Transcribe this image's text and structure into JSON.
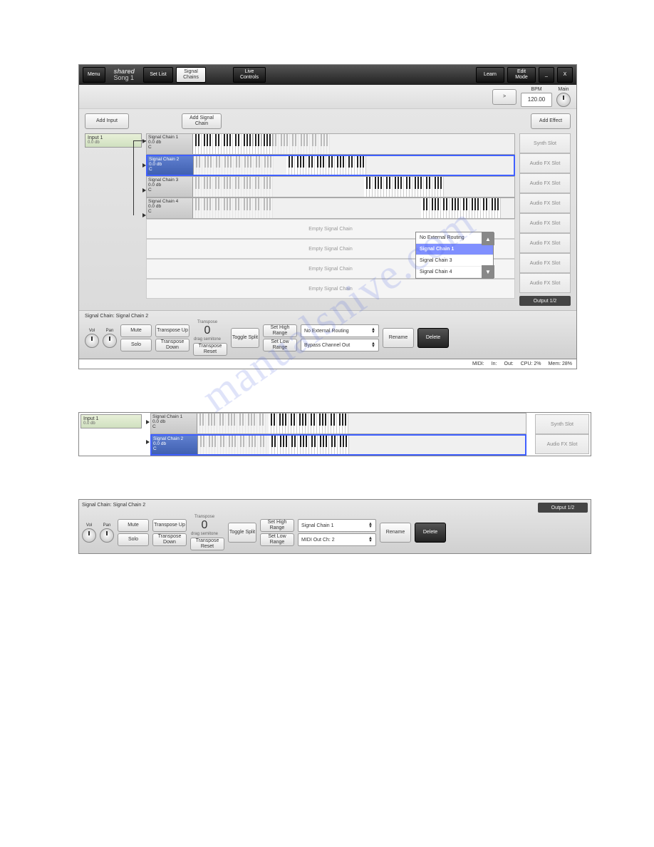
{
  "topbar": {
    "menu": "Menu",
    "shared": "shared",
    "song": "Song 1",
    "setlist": "Set\nList",
    "signalchains": "Signal\nChains",
    "livecontrols": "Live\nControls",
    "learn": "Learn",
    "editmode": "Edit\nMode",
    "min": "_",
    "close": "X"
  },
  "subhead": {
    "play": ">",
    "bpm_label": "BPM",
    "bpm": "120.00",
    "main": "Main"
  },
  "buttons": {
    "addinput": "Add Input",
    "addchain": "Add\nSignal Chain",
    "addeffect": "Add Effect"
  },
  "input": {
    "name": "Input 1",
    "level": "0.0 db"
  },
  "chains": [
    {
      "name": "Signal Chain 1",
      "db": "0.0 db",
      "note": "C"
    },
    {
      "name": "Signal Chain 2",
      "db": "0.0 db",
      "note": "C"
    },
    {
      "name": "Signal Chain 3",
      "db": "0.0 db",
      "note": "C"
    },
    {
      "name": "Signal Chain 4",
      "db": "0.0 db",
      "note": "C"
    }
  ],
  "empties": [
    "Empty Signal Chain",
    "Empty Signal Chain",
    "Empty Signal Chain",
    "Empty Signal Chain"
  ],
  "dropdown": {
    "items": [
      "No External Routing",
      "Signal Chain 1",
      "Signal Chain 3",
      "Signal Chain 4"
    ],
    "selected": 1
  },
  "slots": [
    "Synth Slot",
    "Audio FX Slot",
    "Audio FX Slot",
    "Audio FX Slot",
    "Audio FX Slot",
    "Audio FX Slot",
    "Audio FX Slot",
    "Audio FX Slot"
  ],
  "output": "Output 1/2",
  "ctrl": {
    "title": "Signal Chain: Signal Chain 2",
    "vol": "Vol",
    "pan": "Pan",
    "mute": "Mute",
    "solo": "Solo",
    "trup": "Transpose\nUp",
    "trdown": "Transpose\nDown",
    "trreset": "Transpose\nReset",
    "trlabel": "Transpose",
    "trval": "0",
    "trsub": "drag semitone",
    "toggle": "Toggle\nSplit",
    "sethigh": "Set High\nRange",
    "setlow": "Set Low\nRange",
    "sel1": "No External Routing",
    "sel2": "Bypass Channel Out",
    "rename": "Rename",
    "delete": "Delete"
  },
  "section3": {
    "sel1": "Signal Chain 1",
    "sel2": "MIDI Out Ch: 2"
  },
  "status": {
    "midi": "MIDI:",
    "in": "In:",
    "out": "Out:",
    "cpu": "CPU: 2%",
    "mem": "Mem: 28%"
  }
}
